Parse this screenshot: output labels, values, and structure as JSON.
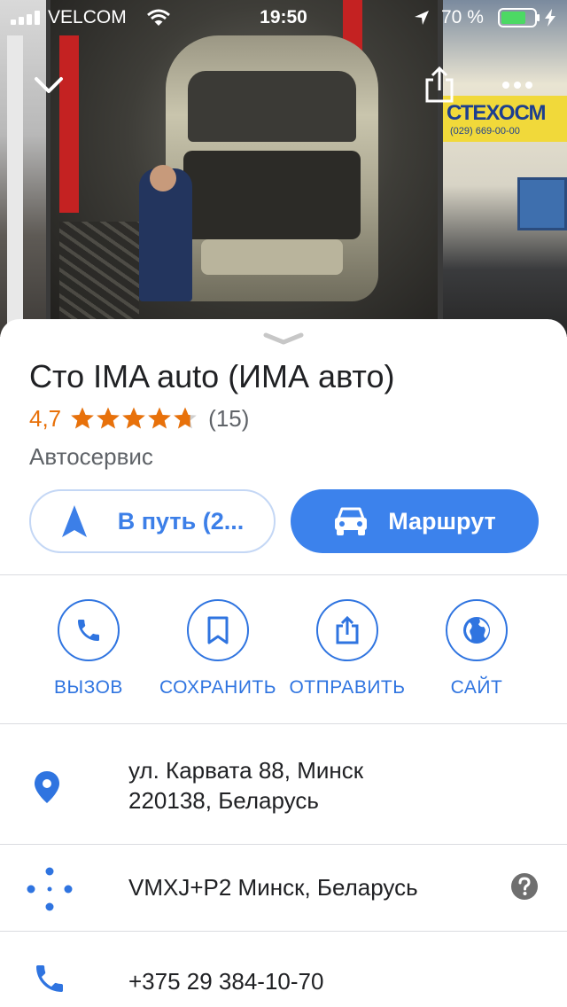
{
  "status_bar": {
    "carrier": "VELCOM",
    "time": "19:50",
    "battery": "70 %"
  },
  "place": {
    "title": "Сто IMA auto (ИМА авто)",
    "rating": "4,7",
    "stars_value": 4.7,
    "reviews": "(15)",
    "category": "Автосервис"
  },
  "photo": {
    "sign_text": "СТЕХОСМ",
    "sign_sub": "(029) 669-00-00"
  },
  "buttons": {
    "start": "В путь (2...",
    "route": "Маршрут"
  },
  "actions": [
    {
      "label": "ВЫЗОВ",
      "icon": "phone-icon"
    },
    {
      "label": "СОХРАНИТЬ",
      "icon": "bookmark-icon"
    },
    {
      "label": "ОТПРАВИТЬ",
      "icon": "share-icon"
    },
    {
      "label": "САЙТ",
      "icon": "globe-icon"
    }
  ],
  "info": {
    "address_line1": "ул. Карвата 88, Минск",
    "address_line2": "220138, Беларусь",
    "plus_code": "VMXJ+P2 Минск, Беларусь",
    "phone": "+375 29 384-10-70"
  },
  "colors": {
    "accent": "#3c82ec",
    "rating": "#e8710a",
    "battery": "#4cd964"
  }
}
